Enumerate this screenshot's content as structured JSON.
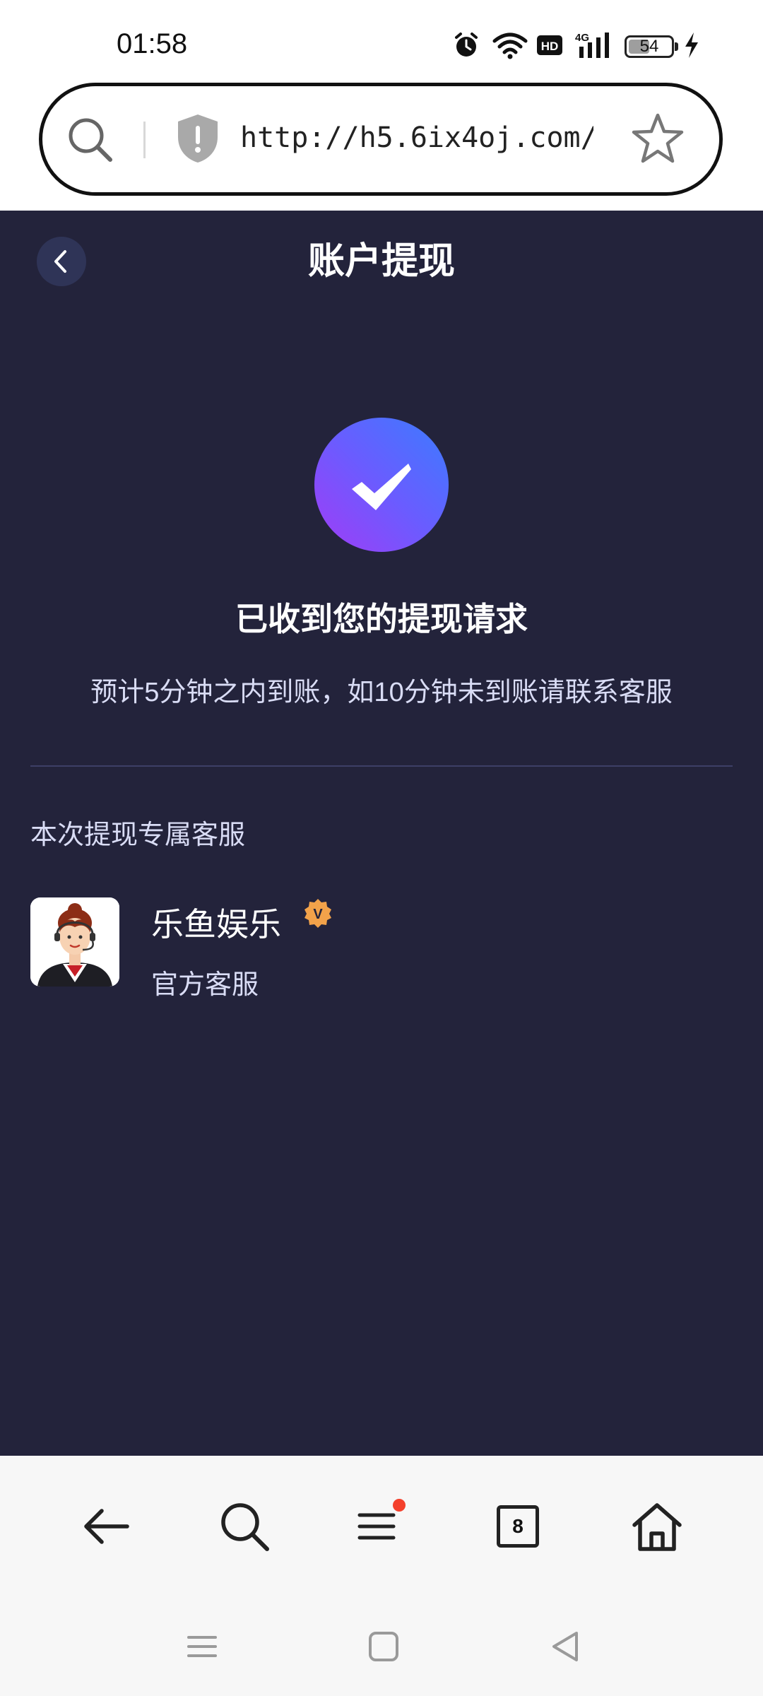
{
  "status_bar": {
    "time": "01:58",
    "battery": {
      "level": "54",
      "fraction": 0.54
    },
    "icons": [
      "alarm-icon",
      "wifi-icon",
      "hd-icon",
      "signal-4g-icon",
      "battery-icon",
      "charging-icon"
    ],
    "network_label": "4G",
    "hd_label": "HD"
  },
  "url_bar": {
    "url": "http://h5.6ix4oj.com/w …",
    "icons": [
      "search-icon",
      "security-warning-icon",
      "bookmark-star-icon"
    ]
  },
  "header": {
    "title": "账户提现"
  },
  "success": {
    "title": "已收到您的提现请求",
    "description": "预计5分钟之内到账，如10分钟未到账请联系客服"
  },
  "service": {
    "section_title": "本次提现专属客服",
    "agent_name": "乐鱼娱乐",
    "agent_role": "官方客服",
    "badge_letter": "V"
  },
  "toolbar": {
    "tabs_count": "8"
  },
  "colors": {
    "page_bg": "#23233b",
    "accent_gradient_start": "#3b7cff",
    "accent_gradient_end": "#a13cf6",
    "badge": "#f2a24a",
    "notification_dot": "#f4402c"
  }
}
